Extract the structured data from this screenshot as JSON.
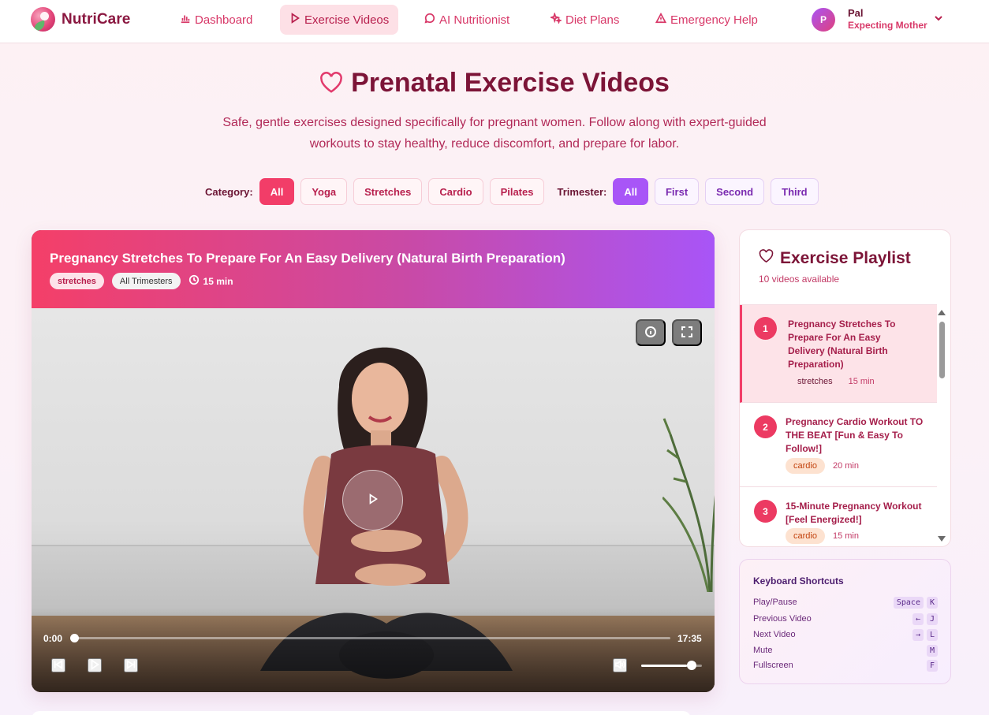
{
  "brand": {
    "name": "NutriCare"
  },
  "nav": {
    "items": [
      {
        "label": "Dashboard",
        "icon": "chart-bar-icon",
        "active": false
      },
      {
        "label": "Exercise Videos",
        "icon": "play-icon",
        "active": true
      },
      {
        "label": "AI Nutritionist",
        "icon": "chat-bubble-icon",
        "active": false
      },
      {
        "label": "Diet Plans",
        "icon": "sparkles-icon",
        "active": false
      },
      {
        "label": "Emergency Help",
        "icon": "warning-triangle-icon",
        "active": false
      }
    ]
  },
  "user": {
    "initial": "P",
    "name": "Pal",
    "role": "Expecting Mother"
  },
  "hero": {
    "title": "Prenatal Exercise Videos",
    "subtitle": "Safe, gentle exercises designed specifically for pregnant women. Follow along with expert-guided workouts to stay healthy, reduce discomfort, and prepare for labor."
  },
  "filters": {
    "category_label": "Category:",
    "categories": [
      "All",
      "Yoga",
      "Stretches",
      "Cardio",
      "Pilates"
    ],
    "category_selected": "All",
    "trimester_label": "Trimester:",
    "trimesters": [
      "All",
      "First",
      "Second",
      "Third"
    ],
    "trimester_selected": "All"
  },
  "video": {
    "title": "Pregnancy Stretches To Prepare For An Easy Delivery (Natural Birth Preparation)",
    "category": "stretches",
    "trimester": "All Trimesters",
    "duration": "15 min",
    "current_time": "0:00",
    "total_time": "17:35",
    "progress": 0.0,
    "volume": 0.75
  },
  "playlist": {
    "title": "Exercise Playlist",
    "count_text": "10 videos available",
    "items": [
      {
        "num": "1",
        "title": "Pregnancy Stretches To Prepare For An Easy Delivery (Natural Birth Preparation)",
        "tag": "stretches",
        "duration": "15 min",
        "active": true
      },
      {
        "num": "2",
        "title": "Pregnancy Cardio Workout TO THE BEAT [Fun & Easy To Follow!]",
        "tag": "cardio",
        "duration": "20 min",
        "active": false
      },
      {
        "num": "3",
        "title": "15-Minute Pregnancy Workout [Feel Energized!]",
        "tag": "cardio",
        "duration": "15 min",
        "active": false
      }
    ]
  },
  "shortcuts": {
    "title": "Keyboard Shortcuts",
    "rows": [
      {
        "label": "Play/Pause",
        "keys": [
          "Space",
          "K"
        ]
      },
      {
        "label": "Previous Video",
        "keys": [
          "←",
          "J"
        ]
      },
      {
        "label": "Next Video",
        "keys": [
          "→",
          "L"
        ]
      },
      {
        "label": "Mute",
        "keys": [
          "M"
        ]
      },
      {
        "label": "Fullscreen",
        "keys": [
          "F"
        ]
      }
    ]
  },
  "colors": {
    "primary_pink": "#f23d68",
    "accent_purple": "#a855f7",
    "brand_dark": "#7c1437"
  }
}
